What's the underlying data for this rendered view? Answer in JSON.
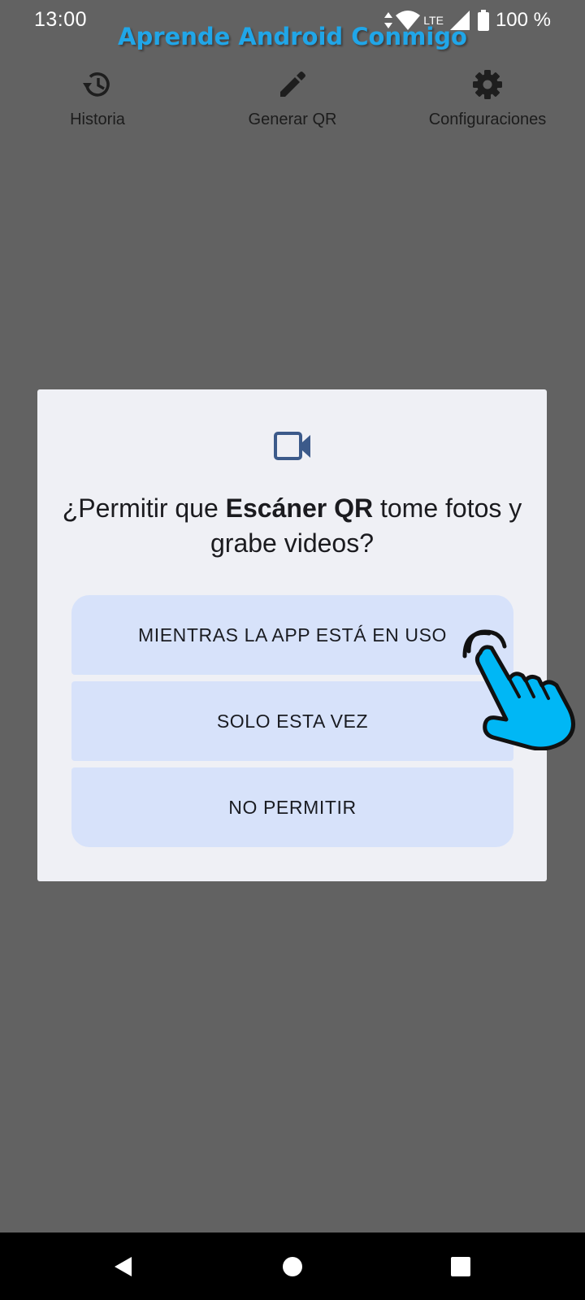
{
  "status_bar": {
    "time": "13:00",
    "network": "LTE",
    "battery": "100 %"
  },
  "watermark": "Aprende Android Conmigo",
  "top_nav": {
    "items": [
      {
        "label": "Historia",
        "icon": "history-icon"
      },
      {
        "label": "Generar QR",
        "icon": "edit-pencil-icon"
      },
      {
        "label": "Configuraciones",
        "icon": "gear-icon"
      }
    ]
  },
  "dialog": {
    "icon": "videocam-icon",
    "title_prefix": "¿Permitir que ",
    "title_app": "Escáner QR",
    "title_suffix": " tome fotos y grabe videos?",
    "buttons": [
      {
        "label": "MIENTRAS LA APP ESTÁ EN USO"
      },
      {
        "label": "SOLO ESTA VEZ"
      },
      {
        "label": "NO PERMITIR"
      }
    ]
  },
  "system_nav": {
    "buttons": [
      "back-icon",
      "home-icon",
      "recents-icon"
    ]
  },
  "colors": {
    "scrim_background": "#626262",
    "dialog_background": "#eff0f5",
    "button_background": "#d7e2fa",
    "icon_accent": "#3c5a8a",
    "watermark": "#20a6e8",
    "hand_fill": "#00b7f5"
  }
}
